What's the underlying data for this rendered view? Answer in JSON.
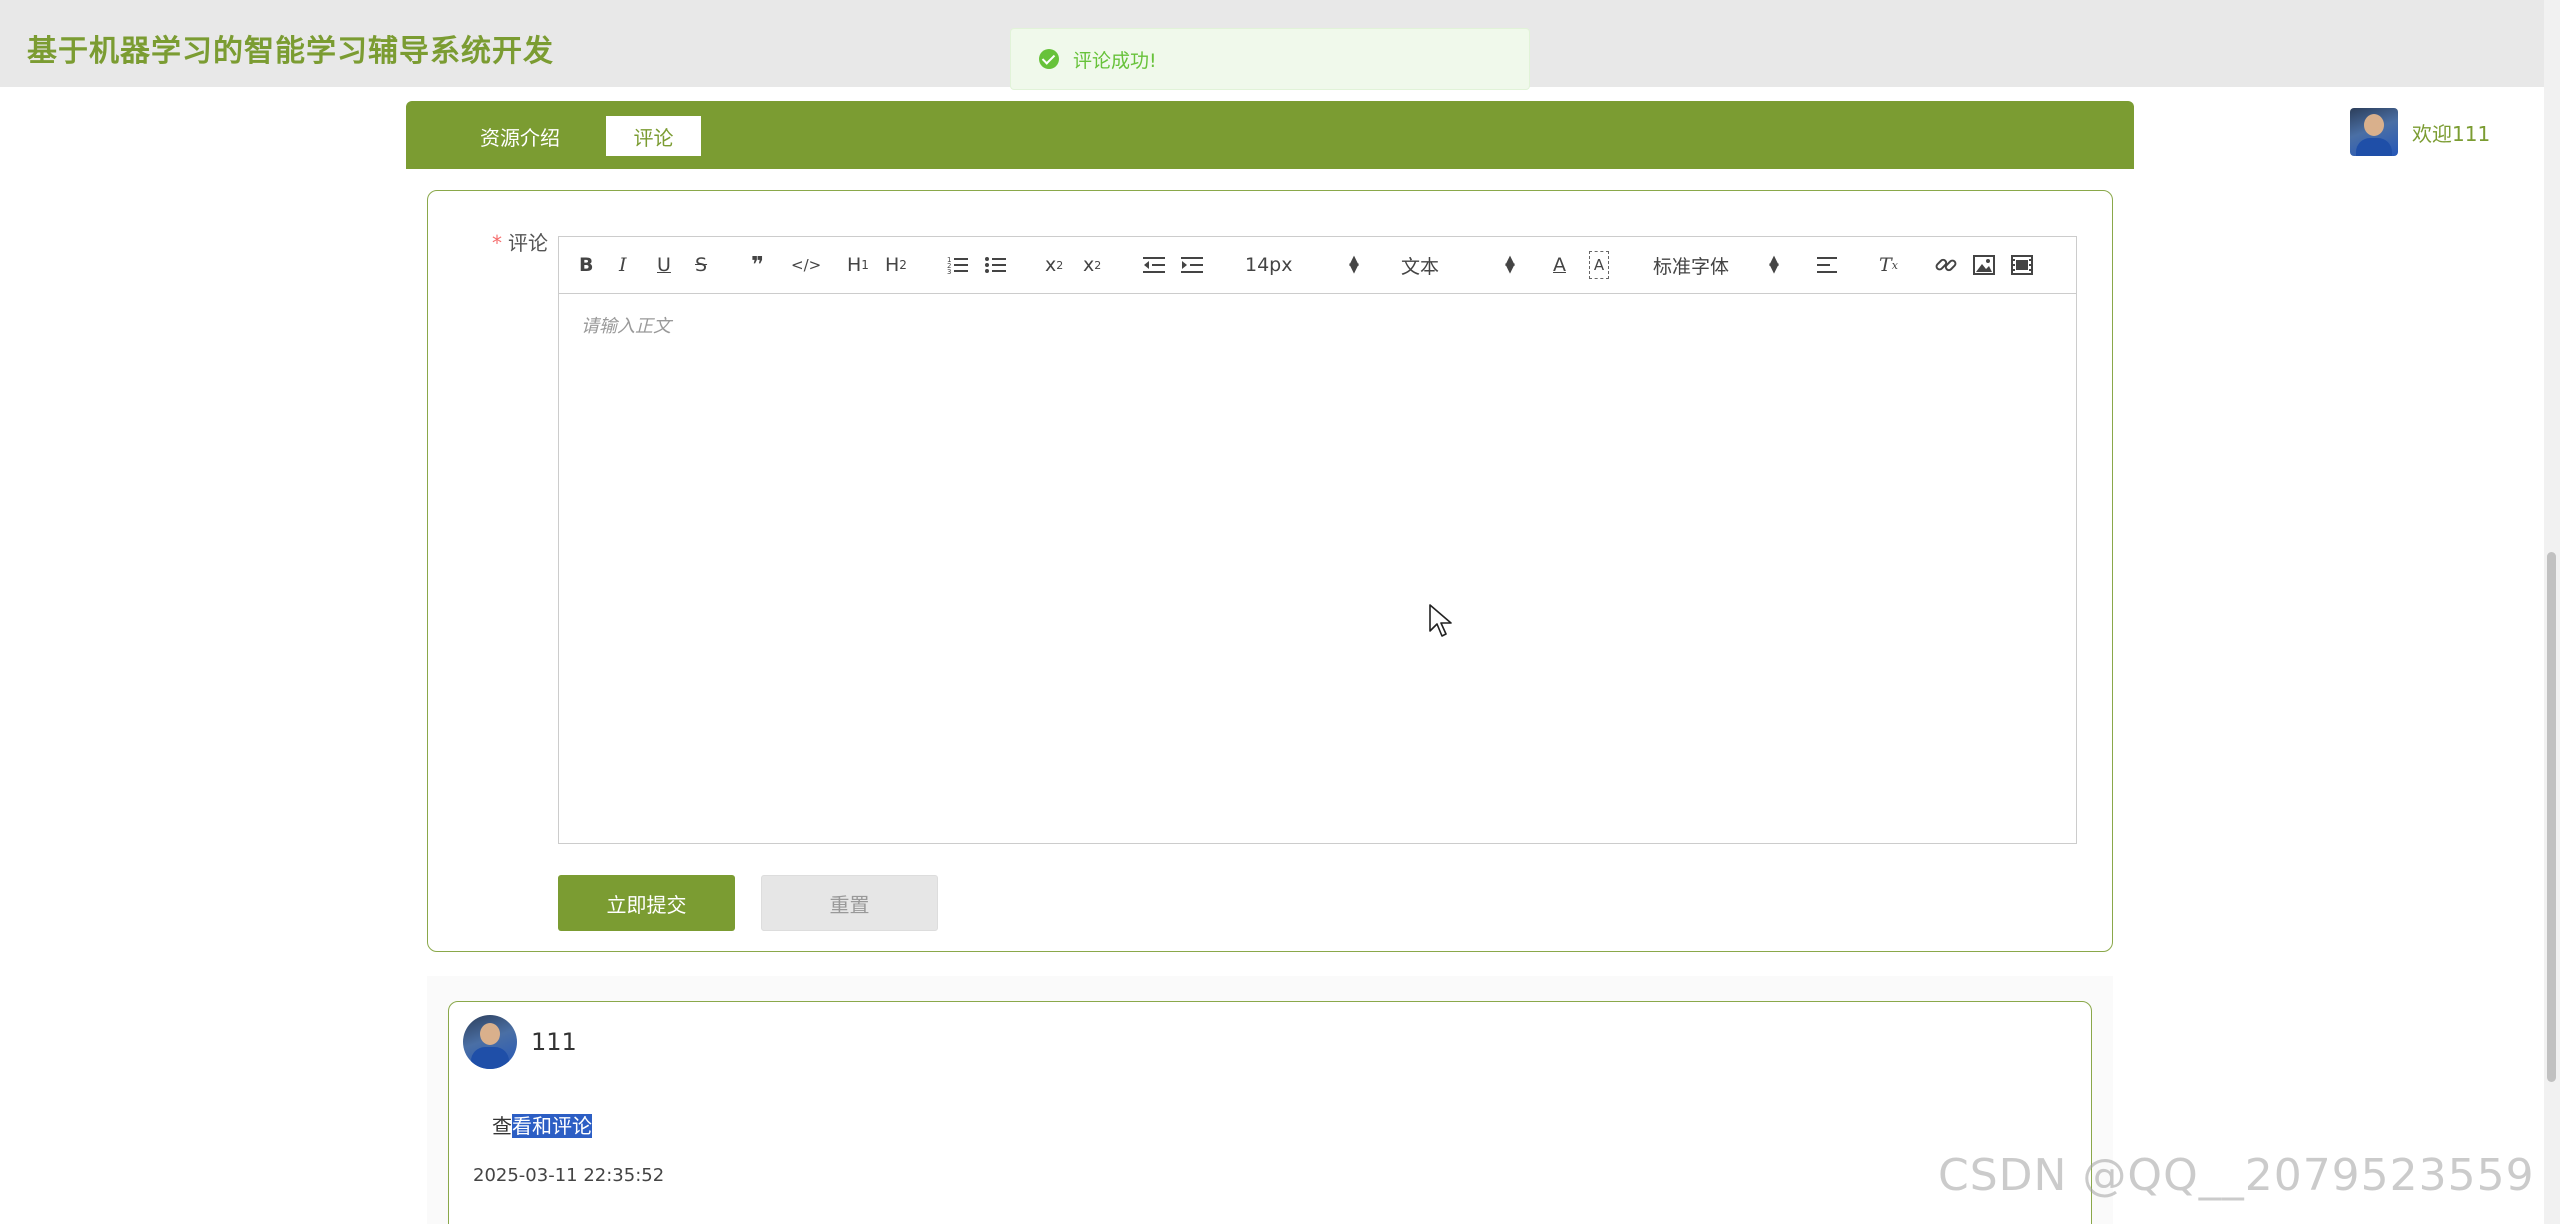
{
  "header": {
    "title": "基于机器学习的智能学习辅导系统开发"
  },
  "toast": {
    "message": "评论成功!",
    "icon": "success-check-icon",
    "color": "#67c23a"
  },
  "user": {
    "welcome": "欢迎111",
    "avatar": "user-avatar"
  },
  "tabs": [
    {
      "label": "资源介绍",
      "active": false
    },
    {
      "label": "评论",
      "active": true
    }
  ],
  "form": {
    "required_mark": "*",
    "comment_label": "评论",
    "editor": {
      "font_size": "14px",
      "heading_select": "文本",
      "font_family": "标准字体",
      "placeholder": "请输入正文"
    },
    "submit_label": "立即提交",
    "reset_label": "重置"
  },
  "comments": [
    {
      "user": "111",
      "content_plain": "查",
      "content_selected": "看和评论",
      "time": "2025-03-11 22:35:52"
    }
  ],
  "watermark": "CSDN @QQ__2079523559",
  "colors": {
    "brand": "#7b9c32",
    "header_bg": "#e8e8e8",
    "success": "#67c23a",
    "required": "#f56c6c"
  }
}
